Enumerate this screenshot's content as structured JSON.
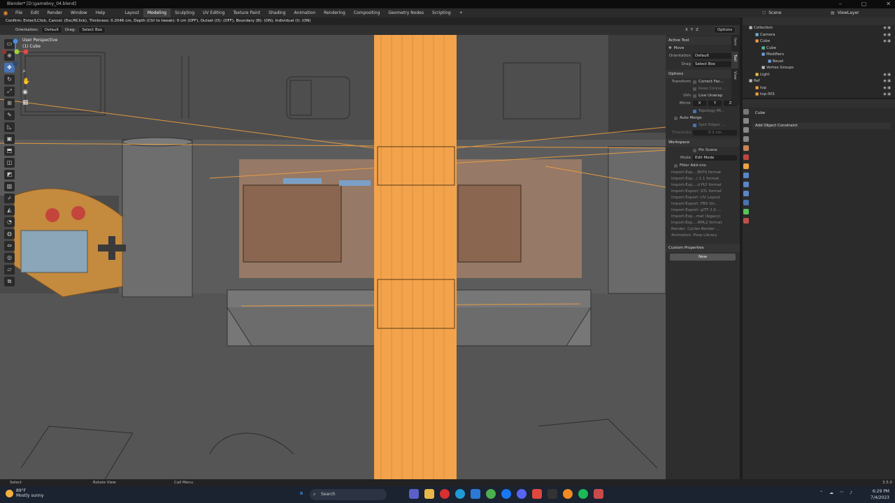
{
  "window": {
    "title": "Blender* [D:\\gameboy_04.blend]",
    "controls": [
      "–",
      "▢",
      "✕"
    ]
  },
  "menus": [
    "File",
    "Edit",
    "Render",
    "Window",
    "Help"
  ],
  "workspaces": [
    "Layout",
    "Modeling",
    "Sculpting",
    "UV Editing",
    "Texture Paint",
    "Shading",
    "Animation",
    "Rendering",
    "Compositing",
    "Geometry Nodes",
    "Scripting",
    "+"
  ],
  "active_workspace": "Modeling",
  "scene": {
    "label": "Scene"
  },
  "view_layer": {
    "label": "ViewLayer"
  },
  "hint": "Confirm: Enter/LClick, Cancel: (Esc/RClick), Thickness: 0.2046 cm, Depth (Ctrl to tweak): 0 cm (OFF), Outset (O): (OFF), Boundary (B): (ON), Individual (I): (ON)",
  "tool_header": {
    "orientation_label": "Orientation:",
    "orientation_value": "Default",
    "drag_label": "Drag:",
    "drag_value": "Select Box",
    "axes": [
      "X",
      "Y",
      "Z"
    ],
    "options": "Options"
  },
  "viewport": {
    "perspective": "User Perspective",
    "object": "(1) Cube"
  },
  "npanel": {
    "tabs": [
      "Item",
      "Tool",
      "View"
    ],
    "active_tool": {
      "title": "Active Tool",
      "tool": "Move",
      "orientation_label": "Orientation",
      "orientation_value": "Default",
      "drag_label": "Drag",
      "drag_value": "Select Box"
    },
    "options": {
      "title": "Options",
      "transform_label": "Transform",
      "correct_face": "Correct Fac...",
      "keep_connected": "Keep Conne...",
      "uvs_label": "UVs",
      "live_unwrap": "Live Unwrap",
      "mirror_label": "Mirror",
      "mirror_axes": [
        "X",
        "Y",
        "Z"
      ],
      "topology": "Topology Mi...",
      "auto_merge": "Auto Merge",
      "split_edges": "Split Edges ...",
      "threshold_label": "Threshold",
      "threshold_value": "0.1 cm"
    },
    "workspace": {
      "title": "Workspace",
      "pin_scene": "Pin Scene",
      "mode_label": "Mode",
      "mode_value": "Edit Mode",
      "filter_addons": "Filter Add-ons"
    },
    "addons": [
      "Import-Exp....BVH) format",
      "Import-Exp...) 1.1 format",
      "Import-Exp....d PLY format",
      "Import-Export: STL format",
      "Import-Export: UV Layout",
      "Import-Export: FBX for...",
      "Import-Export: glTF 2.0 ...",
      "Import-Exp...mat (legacy)",
      "Import-Exp....RML2 format",
      "Render: Cycles Render ...",
      "Animation: Pose Library"
    ],
    "custom_props": {
      "title": "Custom Properties",
      "new": "New"
    }
  },
  "outliner": {
    "items": [
      {
        "label": "Collection",
        "indent": 1,
        "icon": "collection-icon",
        "color": "#bbbbbb"
      },
      {
        "label": "Camera",
        "indent": 2,
        "icon": "camera-icon",
        "color": "#6ab2d6"
      },
      {
        "label": "Cube",
        "indent": 2,
        "icon": "mesh-icon",
        "color": "#f0a040"
      },
      {
        "label": "Cube",
        "indent": 3,
        "icon": "mesh-data-icon",
        "color": "#59c3a0"
      },
      {
        "label": "Modifiers",
        "indent": 3,
        "icon": "wrench-icon",
        "color": "#6fa1e0"
      },
      {
        "label": "Bevel",
        "indent": 4,
        "icon": "bevel-icon",
        "color": "#6fa1e0"
      },
      {
        "label": "Vertex Groups",
        "indent": 3,
        "icon": "vertex-groups-icon",
        "color": "#bbbbbb"
      },
      {
        "label": "Light",
        "indent": 2,
        "icon": "light-icon",
        "color": "#e8c04a"
      },
      {
        "label": "Ref",
        "indent": 1,
        "icon": "collection-icon",
        "color": "#bbbbbb"
      },
      {
        "label": "top",
        "indent": 2,
        "icon": "image-icon",
        "color": "#f0a040"
      },
      {
        "label": "top.001",
        "indent": 2,
        "icon": "image-icon",
        "color": "#f0a040"
      }
    ]
  },
  "properties": {
    "object": "Cube",
    "add_constraint": "Add Object Constraint"
  },
  "status": {
    "select": "Select",
    "rotate": "Rotate View",
    "call_menu": "Call Menu",
    "version": "3.5.0"
  },
  "taskbar": {
    "temp": "89°F",
    "weather": "Mostly sunny",
    "search": "Search",
    "time": "6:29 PM",
    "date": "7/4/2023"
  },
  "colors": {
    "accent": "#4772b3",
    "selection": "#f0a040",
    "header": "#2b2b2b",
    "panel": "#2e2e2e"
  }
}
